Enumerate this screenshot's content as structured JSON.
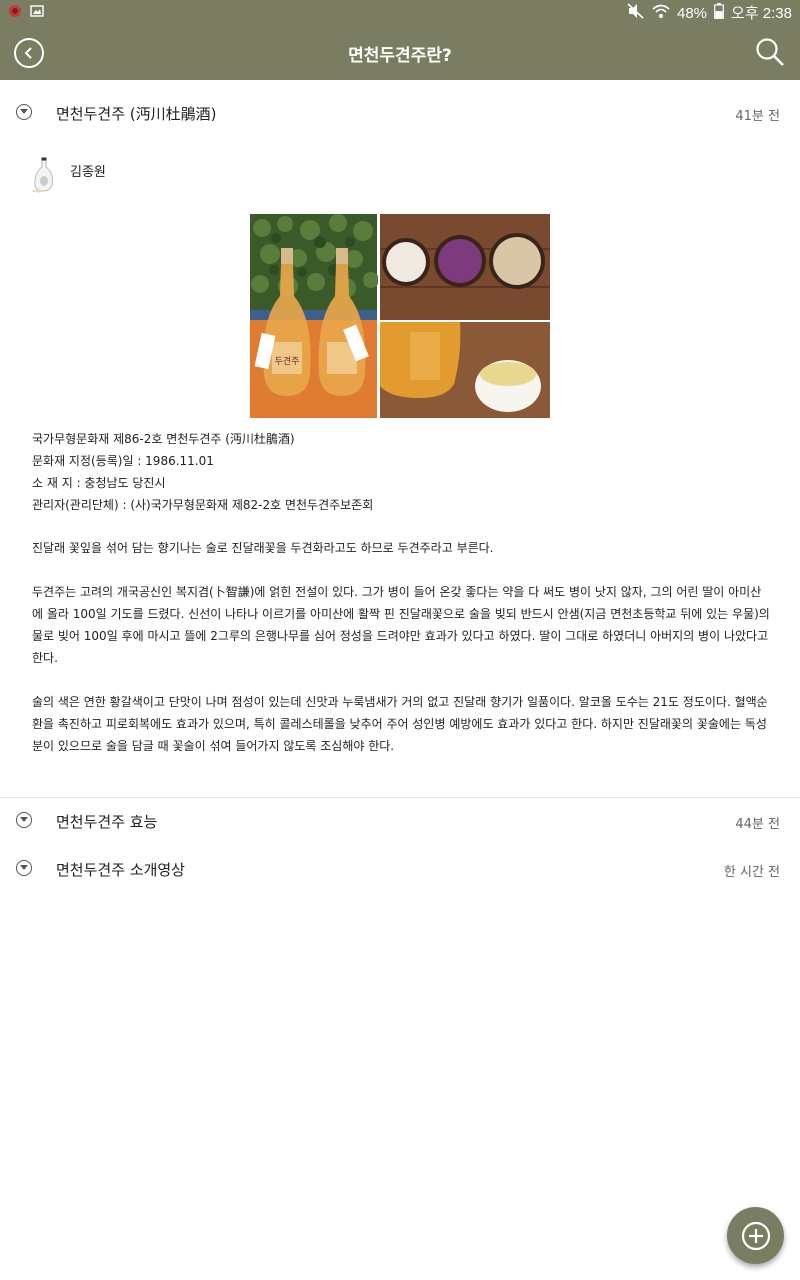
{
  "status_bar": {
    "battery": "48%",
    "time": "오후 2:38"
  },
  "app_bar": {
    "title": "면천두견주란?"
  },
  "threads": [
    {
      "title": "면천두견주 (沔川杜鵑酒)",
      "time": "41분 전",
      "expanded": true,
      "author": "김종원",
      "info_lines": [
        "국가무형문화재 제86-2호 면천두견주 (沔川杜鵑酒)",
        "문화재 지정(등록)일 : 1986.11.01",
        "소 재 지 : 충청남도 당진시",
        "관리자(관리단체) : (사)국가무형문화재 제82-2호 면천두견주보존회"
      ],
      "paragraphs": [
        "진달래 꽃잎을 섞어 담는 향기나는 술로 진달래꽃을 두견화라고도 하므로 두견주라고 부른다.",
        "두견주는 고려의 개국공신인 복지겸(卜智謙)에 얽힌 전설이 있다. 그가 병이 들어 온갖 좋다는 약을 다 써도 병이 낫지 않자, 그의 어린 딸이 아미산에 올라 100일 기도를 드렸다. 신선이 나타나 이르기를 아미산에 활짝 핀 진달래꽃으로 술을 빚되 반드시 안샘(지금 면천초등학교 뒤에 있는 우물)의 물로 빚어 100일 후에 마시고 뜰에 2그루의 은행나무를 심어 정성을 드려야만 효과가 있다고 하였다. 딸이 그대로 하였더니 아버지의 병이 나았다고 한다.",
        "술의 색은 연한 황갈색이고 단맛이 나며 점성이 있는데 신맛과 누룩냄새가 거의 없고 진달래 향기가 일품이다. 알코올 도수는 21도 정도이다. 혈액순환을 촉진하고 피로회복에도 효과가 있으며, 특히 콜레스테롤을 낮추어 주어 성인병 예방에도 효과가 있다고 한다. 하지만 진달래꽃의 꽃술에는 독성분이 있으므로 술을 담글 때 꽃술이 섞여 들어가지 않도록 조심해야 한다."
      ],
      "photo": {
        "bottle_label": "두견주"
      }
    },
    {
      "title": "면천두견주 효능",
      "time": "44분 전",
      "expanded": false
    },
    {
      "title": "면천두견주 소개영상",
      "time": "한 시간 전",
      "expanded": false
    }
  ],
  "colors": {
    "header": "#7a7d62",
    "divider": "#e2e2e2"
  },
  "icons": [
    "app-notification-icon",
    "image-notification-icon",
    "mute-icon",
    "wifi-icon",
    "battery-icon",
    "back-icon",
    "search-icon",
    "expand-toggle-icon",
    "add-icon"
  ]
}
